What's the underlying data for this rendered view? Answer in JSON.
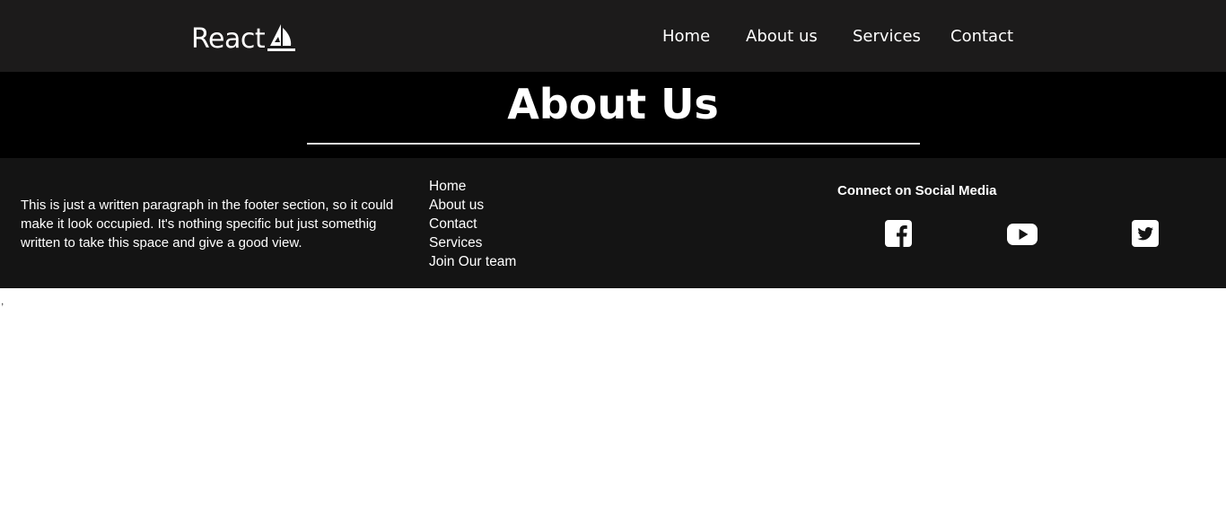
{
  "brand": {
    "name": "React",
    "logo_icon": "sailboat-logo-icon"
  },
  "nav": {
    "items": [
      {
        "label": "Home"
      },
      {
        "label": "About us"
      },
      {
        "label": "Services"
      },
      {
        "label": "Contact"
      }
    ]
  },
  "hero": {
    "title": "About Us"
  },
  "footer": {
    "paragraph": "This is just a written paragraph in the footer section, so it could make it look occupied. It's nothing specific but just somethig written to take this space and give a good view.",
    "links": [
      {
        "label": "Home"
      },
      {
        "label": "About us"
      },
      {
        "label": "Contact"
      },
      {
        "label": "Services"
      },
      {
        "label": "Join Our team"
      }
    ],
    "social": {
      "heading": "Connect on Social Media",
      "icons": [
        "facebook-icon",
        "youtube-icon",
        "twitter-icon"
      ]
    }
  },
  "stray_text": ",",
  "colors": {
    "navbar_bg": "#1c1b1b",
    "hero_bg": "#000000",
    "footer_bg": "#141414",
    "text": "#ffffff"
  }
}
